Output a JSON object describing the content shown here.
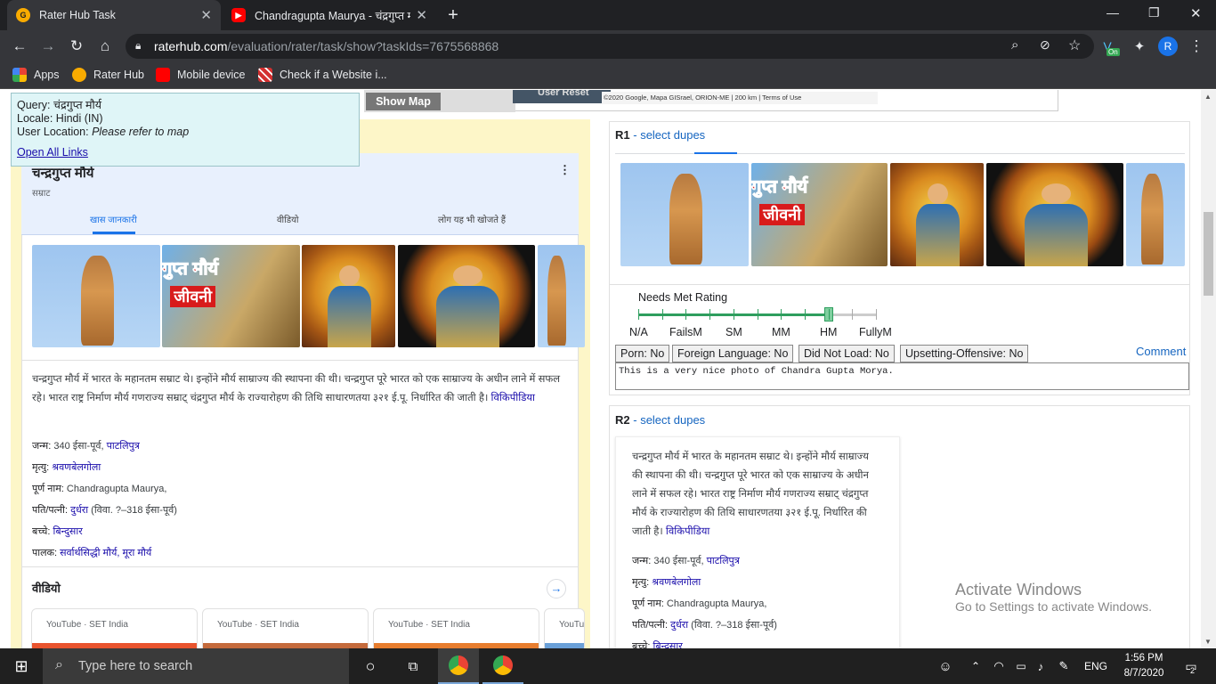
{
  "browser": {
    "tabs": [
      {
        "title": "Rater Hub Task",
        "active": true
      },
      {
        "title": "Chandragupta Maurya - चंद्रगुप्त म",
        "active": false
      }
    ],
    "url_host": "raterhub.com",
    "url_path": "/evaluation/rater/task/show?taskIds=7675568868",
    "bookmarks": [
      "Apps",
      "Rater Hub",
      "Mobile device",
      "Check if a Website i..."
    ],
    "profile_initial": "R",
    "ext_badge": "On"
  },
  "map": {
    "show_map_label": "Show Map",
    "attribution": "©2020 Google, Mapa GISrael, ORION-ME | 200 km | Terms of Use",
    "user_btn": "User",
    "reset_btn": "Reset"
  },
  "infobox": {
    "query_label": "Query:",
    "query": "चंद्रगुप्त मौर्य",
    "locale_label": "Locale:",
    "locale": "Hindi (IN)",
    "location_label": "User Location:",
    "location": "Please refer to map",
    "open_links": "Open All Links"
  },
  "kp": {
    "title": "चन्द्रगुप्त मौर्य",
    "subtitle": "सम्राट",
    "tabs": [
      "खास जानकारी",
      "वीडियो",
      "लोग यह भी खोजते हैं"
    ],
    "description": "चन्द्रगुप्त मौर्य में भारत के महानतम सम्राट थे। इन्होंने मौर्य साम्राज्य की स्थापना की थी। चन्द्रगुप्त पूरे भारत को एक साम्राज्य के अधीन लाने में सफल रहे। भारत राष्ट्र निर्माण मौर्य गणराज्य सम्राट् चंद्रगुप्त मौर्य के राज्यारोहण की तिथि साधारणतया ३२१ ई.पू. निर्धारित की जाती है।",
    "source": "विकिपीडिया",
    "poster_line1": "गुप्त मौर्य",
    "poster_line2": "जीवनी",
    "facts": [
      {
        "label": "जन्म:",
        "text": "340 ईसा-पूर्व,",
        "link": "पाटलिपुत्र"
      },
      {
        "label": "मृत्यु:",
        "text": "",
        "link": "श्रवणबेलगोला"
      },
      {
        "label": "पूर्ण नाम:",
        "text": "Chandragupta Maurya,",
        "link": ""
      },
      {
        "label": "पति/पत्नी:",
        "text": "",
        "link": "दुर्धरा",
        "extra": "(विवा. ?–318 ईसा-पूर्व)"
      },
      {
        "label": "बच्चे:",
        "text": "",
        "link": "बिन्दुसार"
      },
      {
        "label": "पालक:",
        "text": "",
        "link": "सर्वार्थसिद्धी मौर्य, मूरा मौर्य"
      }
    ],
    "videos_heading": "वीडियो",
    "video_sources": [
      "YouTube · SET India",
      "YouTube · SET India",
      "YouTube · SET India",
      "YouTu"
    ]
  },
  "r1": {
    "label": "R1",
    "dupes": "- select dupes",
    "needs_met": "Needs Met Rating",
    "scale": [
      "N/A",
      "FailsM",
      "SM",
      "MM",
      "HM",
      "FullyM"
    ],
    "rating_value": "HM",
    "flags": [
      "Porn: No",
      "Foreign Language: No",
      "Did Not Load: No",
      "Upsetting-Offensive: No"
    ],
    "comment_label": "Comment",
    "comment": "This is a very nice photo of Chandra Gupta Morya."
  },
  "r2": {
    "label": "R2",
    "dupes": "- select dupes",
    "description": "चन्द्रगुप्त मौर्य में भारत के महानतम सम्राट थे। इन्होंने मौर्य साम्राज्य की स्थापना की थी। चन्द्रगुप्त पूरे भारत को एक साम्राज्य के अधीन लाने में सफल रहे। भारत राष्ट्र निर्माण मौर्य गणराज्य सम्राट् चंद्रगुप्त मौर्य के राज्यारोहण की तिथि साधारणतया ३२१ ई.पू. निर्धारित की जाती है।",
    "source": "विकिपीडिया",
    "facts": [
      {
        "label": "जन्म:",
        "text": "340 ईसा-पूर्व,",
        "link": "पाटलिपुत्र"
      },
      {
        "label": "मृत्यु:",
        "text": "",
        "link": "श्रवणबेलगोला"
      },
      {
        "label": "पूर्ण नाम:",
        "text": "Chandragupta Maurya,",
        "link": ""
      },
      {
        "label": "पति/पत्नी:",
        "text": "",
        "link": "दुर्धरा",
        "extra": "(विवा. ?–318 ईसा-पूर्व)"
      },
      {
        "label": "बच्चे:",
        "text": "",
        "link": "बिन्दुसार"
      }
    ]
  },
  "watermark": {
    "line1": "Activate Windows",
    "line2": "Go to Settings to activate Windows."
  },
  "taskbar": {
    "search_placeholder": "Type here to search",
    "lang": "ENG",
    "time": "1:56 PM",
    "date": "8/7/2020",
    "notif_count": "2"
  },
  "colors": {
    "accent": "#1565c0",
    "slider": "#2e9e5e",
    "infobox": "#dff5f7",
    "left_panel": "#fdf6c8"
  }
}
